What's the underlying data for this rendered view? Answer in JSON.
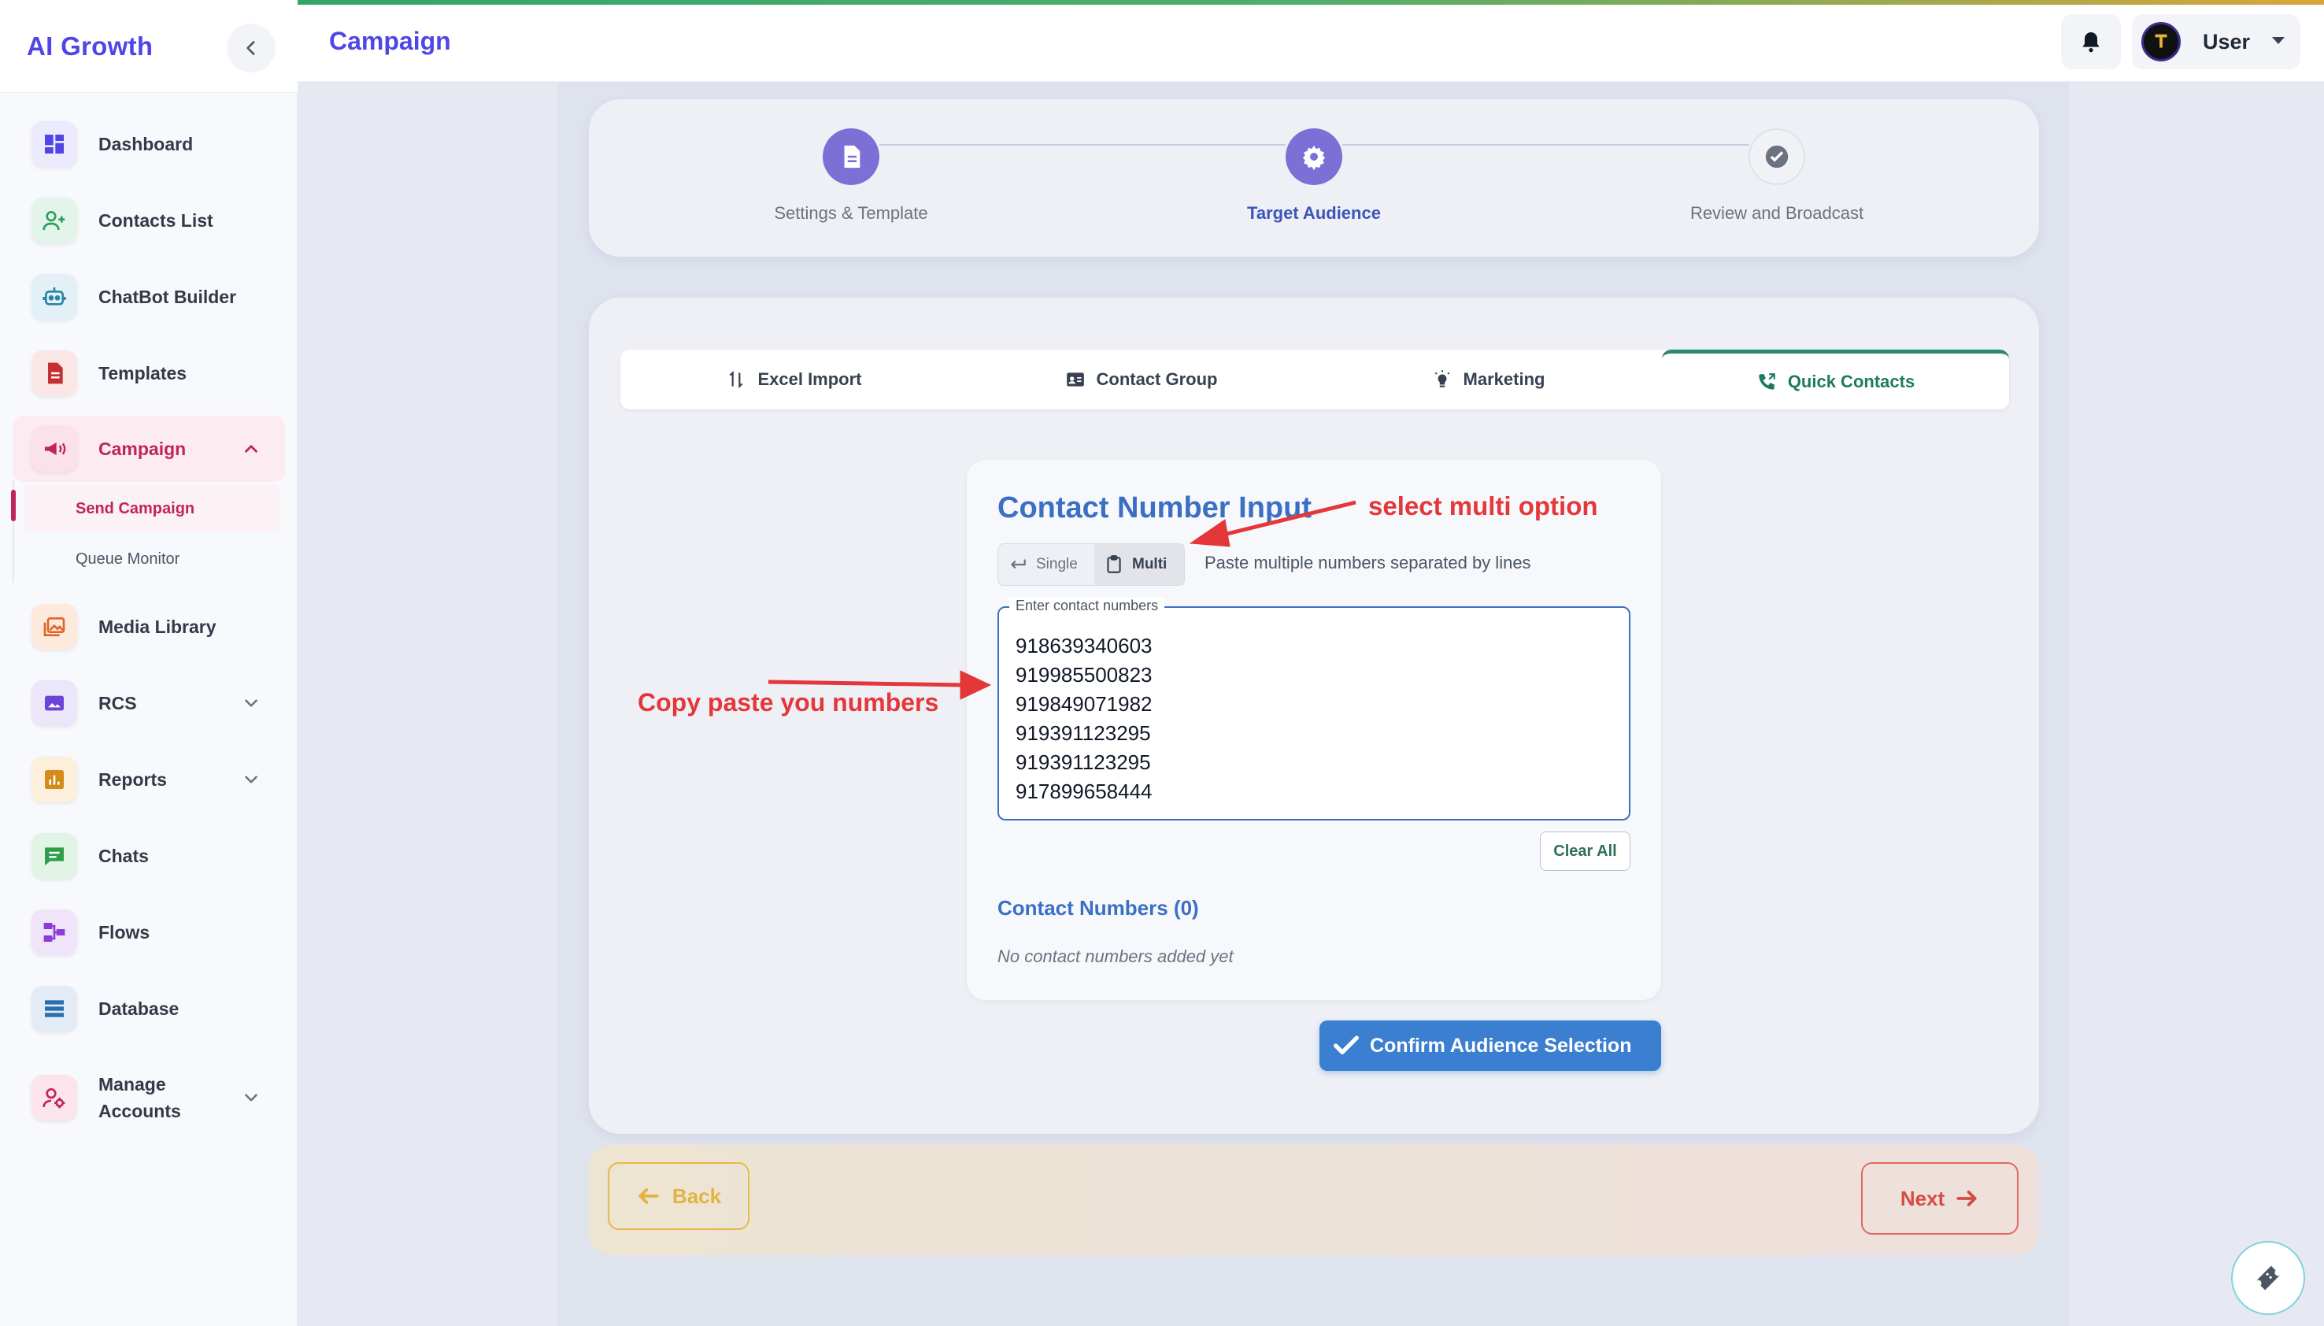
{
  "brand": "AI Growth",
  "header": {
    "title": "Campaign",
    "user_name": "User"
  },
  "sidebar": {
    "items": [
      {
        "label": "Dashboard"
      },
      {
        "label": "Contacts List"
      },
      {
        "label": "ChatBot Builder"
      },
      {
        "label": "Templates"
      },
      {
        "label": "Campaign"
      },
      {
        "label": "Media Library"
      },
      {
        "label": "RCS"
      },
      {
        "label": "Reports"
      },
      {
        "label": "Chats"
      },
      {
        "label": "Flows"
      },
      {
        "label": "Database"
      },
      {
        "label": "Manage\nAccounts"
      }
    ],
    "campaign_sub": [
      {
        "label": "Send Campaign"
      },
      {
        "label": "Queue Monitor"
      }
    ]
  },
  "stepper": {
    "steps": [
      {
        "label": "Settings & Template"
      },
      {
        "label": "Target Audience"
      },
      {
        "label": "Review and Broadcast"
      }
    ]
  },
  "tabs": [
    {
      "label": "Excel Import"
    },
    {
      "label": "Contact Group"
    },
    {
      "label": "Marketing"
    },
    {
      "label": "Quick Contacts"
    }
  ],
  "contact_input": {
    "title": "Contact Number Input",
    "single_label": "Single",
    "multi_label": "Multi",
    "hint": "Paste multiple numbers separated by lines",
    "field_label": "Enter contact numbers",
    "numbers": [
      "918639340603",
      "919985500823",
      "919849071982",
      "919391123295",
      "919391123295",
      "917899658444"
    ],
    "clear_label": "Clear All",
    "count_title": "Contact Numbers (0)",
    "empty_message": "No contact numbers added yet"
  },
  "confirm_label": "Confirm Audience Selection",
  "footer": {
    "back_label": "Back",
    "next_label": "Next"
  },
  "annotations": {
    "multi_note": "select multi option",
    "paste_note": "Copy paste you numbers"
  },
  "colors": {
    "brand": "#4f46e5",
    "active_step": "#7c6fd6",
    "tab_active": "#2a8a6f",
    "confirm": "#3b7fd0",
    "annotation": "#e4373a"
  }
}
